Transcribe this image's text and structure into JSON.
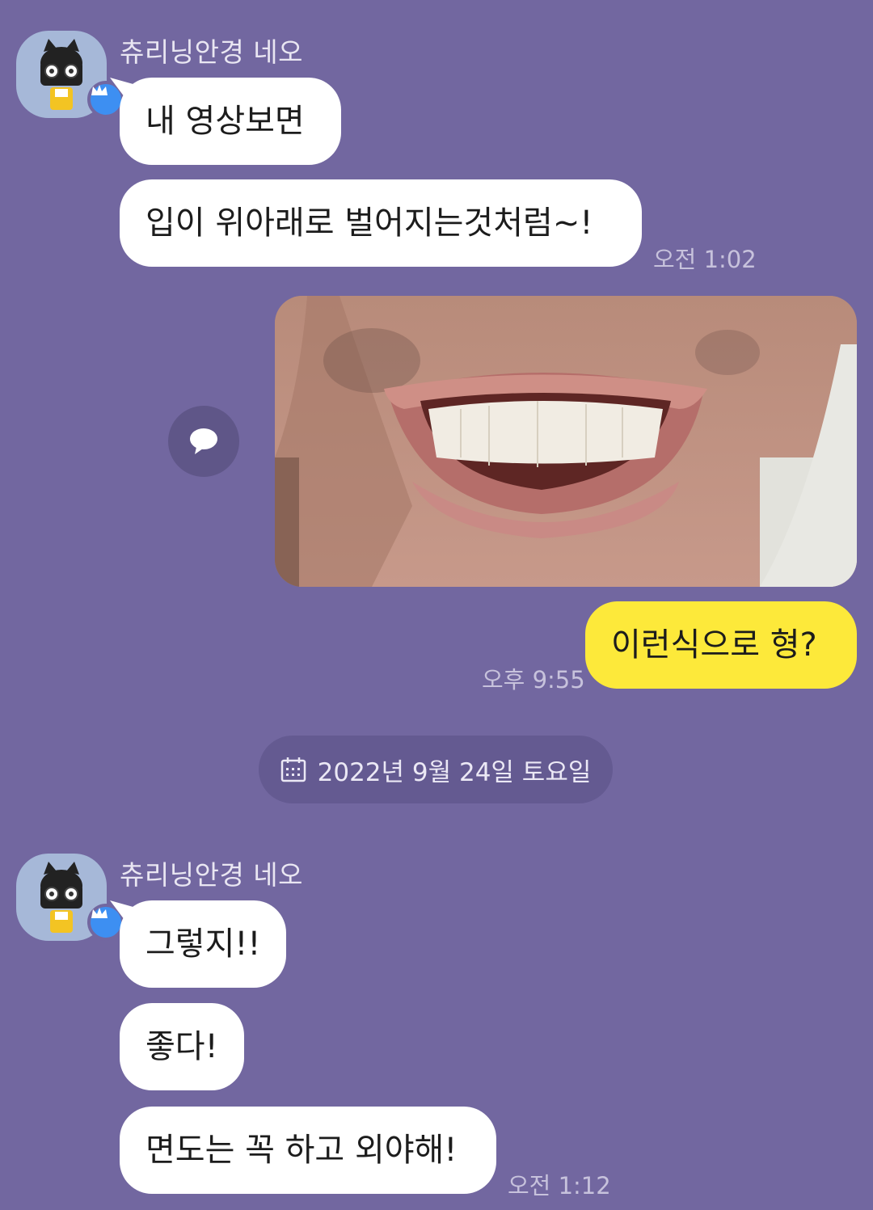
{
  "groups": [
    {
      "sender": "츄리닝안경 네오",
      "messages": [
        "내 영상보면",
        "입이 위아래로 벌어지는것처럼~!"
      ],
      "time": "오전 1:02"
    },
    {
      "sender": "츄리닝안경 네오",
      "messages": [
        "그렇지!!",
        "좋다!",
        "면도는 꼭 하고 외야해!"
      ],
      "time": "오전 1:12"
    }
  ],
  "my_message": {
    "text": "이런식으로 형?",
    "time": "오후 9:55"
  },
  "date_divider": "2022년 9월 24일 토요일",
  "icons": {
    "avatar": "kakao-neo-character-icon",
    "badge": "crown-icon",
    "share": "speech-bubble-icon",
    "date": "calendar-icon"
  },
  "colors": {
    "background": "#7267a0",
    "my_bubble": "#fde93a",
    "other_bubble": "#ffffff",
    "badge": "#3d8ff2"
  }
}
